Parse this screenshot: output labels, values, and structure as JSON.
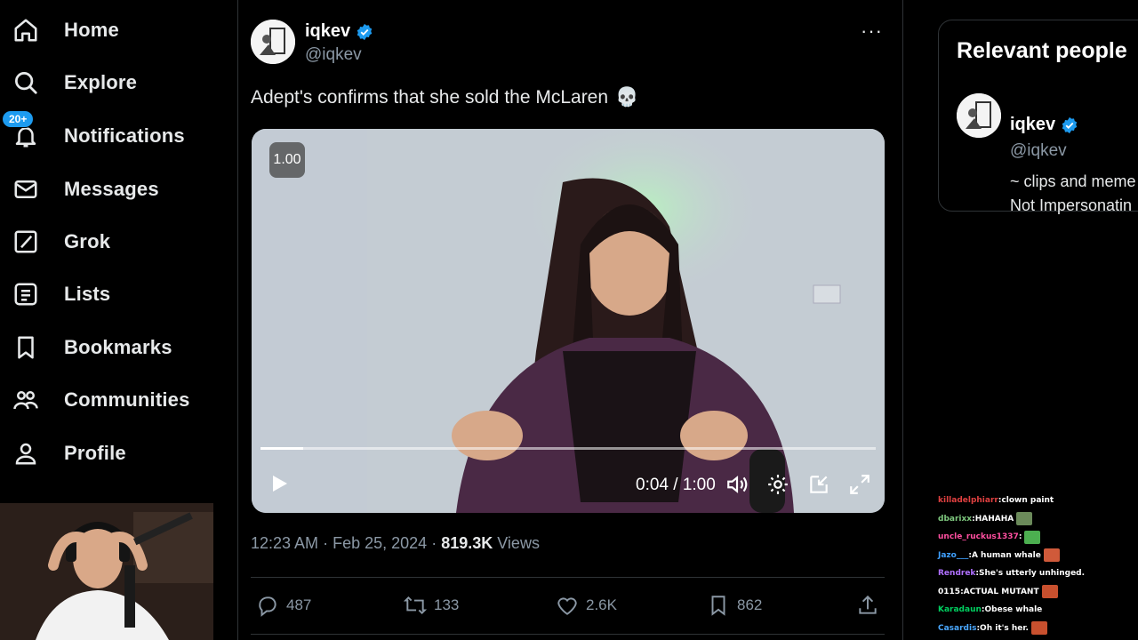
{
  "nav": {
    "items": [
      {
        "label": "Home",
        "icon": "home-icon"
      },
      {
        "label": "Explore",
        "icon": "search-icon"
      },
      {
        "label": "Notifications",
        "icon": "bell-icon",
        "badge": "20+"
      },
      {
        "label": "Messages",
        "icon": "envelope-icon"
      },
      {
        "label": "Grok",
        "icon": "grok-icon"
      },
      {
        "label": "Lists",
        "icon": "list-icon"
      },
      {
        "label": "Bookmarks",
        "icon": "bookmark-icon"
      },
      {
        "label": "Communities",
        "icon": "people-icon"
      },
      {
        "label": "Profile",
        "icon": "person-icon"
      }
    ]
  },
  "tweet": {
    "name": "iqkev",
    "handle": "@iqkev",
    "text": "Adept's confirms that she sold the McLaren",
    "emoji": "💀",
    "video": {
      "speed": "1.00",
      "time": "0:04 / 1:00",
      "progress": 0.07
    },
    "time": "12:23 AM",
    "date": "Feb 25, 2024",
    "views": "819.3K",
    "views_label": "Views",
    "replies": "487",
    "retweets": "133",
    "likes": "2.6K",
    "bookmarks": "862",
    "accent": "#1d9bf0"
  },
  "relevant": {
    "title": "Relevant people",
    "name": "iqkev",
    "handle": "@iqkev",
    "bio_line1": "~ clips and meme",
    "bio_line2": "Not Impersonatin"
  },
  "chat": [
    {
      "user": "killadelphiarr",
      "color": "#e04040",
      "msg": "clown paint",
      "emote": ""
    },
    {
      "user": "dbarixx",
      "color": "#7fc97f",
      "msg": "HAHAHA",
      "emote": "#6b8a5a"
    },
    {
      "user": "uncle_ruckus1337",
      "color": "#ff4fa0",
      "msg": "",
      "emote": "#4caf50"
    },
    {
      "user": "Jazo___",
      "color": "#3fa0ff",
      "msg": "A human whale",
      "emote": "#d05a3a"
    },
    {
      "user": "Rendrek",
      "color": "#b070ff",
      "msg": "She's utterly unhinged.",
      "emote": ""
    },
    {
      "user": "0115",
      "color": "#ffffff",
      "msg": "ACTUAL MUTANT",
      "emote": "#c8502e"
    },
    {
      "user": "Karadaun",
      "color": "#00d060",
      "msg": "Obese whale",
      "emote": ""
    },
    {
      "user": "Casardis",
      "color": "#4aa8ff",
      "msg": "Oh it's her.",
      "emote": "#c8502e"
    }
  ]
}
